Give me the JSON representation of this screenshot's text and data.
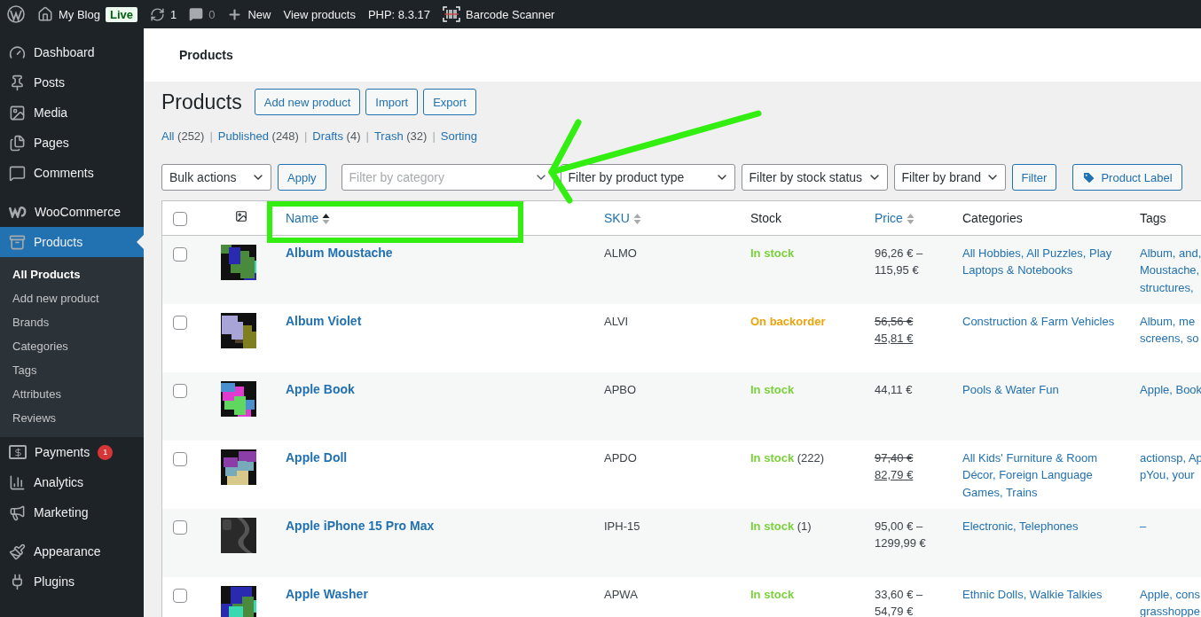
{
  "admin_bar": {
    "site": "My Blog",
    "site_badge": "Live",
    "updates": "1",
    "comments": "0",
    "new": "New",
    "links": [
      "View products",
      "PHP: 8.3.17"
    ],
    "scanner": "Barcode Scanner"
  },
  "sidebar": {
    "items": [
      {
        "kind": "dashboard",
        "label": "Dashboard",
        "selected": false
      },
      {
        "kind": "posts",
        "label": "Posts",
        "selected": false
      },
      {
        "kind": "media",
        "label": "Media",
        "selected": false
      },
      {
        "kind": "pages",
        "label": "Pages",
        "selected": false
      },
      {
        "kind": "comments",
        "label": "Comments",
        "selected": false
      },
      {
        "kind": "woo",
        "label": "WooCommerce",
        "selected": false
      },
      {
        "kind": "products",
        "label": "Products",
        "selected": true,
        "children": [
          {
            "label": "All Products",
            "selected": true
          },
          {
            "label": "Add new product",
            "selected": false
          },
          {
            "label": "Brands",
            "selected": false
          },
          {
            "label": "Categories",
            "selected": false
          },
          {
            "label": "Tags",
            "selected": false
          },
          {
            "label": "Attributes",
            "selected": false
          },
          {
            "label": "Reviews",
            "selected": false
          }
        ]
      },
      {
        "kind": "payments",
        "label": "Payments",
        "selected": false,
        "badge": "1"
      },
      {
        "kind": "analytics",
        "label": "Analytics",
        "selected": false
      },
      {
        "kind": "marketing",
        "label": "Marketing",
        "selected": false
      },
      {
        "kind": "appearance",
        "label": "Appearance",
        "selected": false
      },
      {
        "kind": "plugins",
        "label": "Plugins",
        "selected": false
      }
    ]
  },
  "header": {
    "title": "Products"
  },
  "page": {
    "title": "Products",
    "buttons": [
      "Add new product",
      "Import",
      "Export"
    ]
  },
  "views": [
    {
      "label": "All",
      "count": "(252)",
      "selected": false
    },
    {
      "separator": "|",
      "label": "Published",
      "count": "(248)",
      "selected": false
    },
    {
      "separator": "|",
      "label": "Drafts",
      "count": "(4)",
      "selected": false
    },
    {
      "separator": "|",
      "label": "Trash",
      "count": "(32)",
      "selected": false
    },
    {
      "separator": "|",
      "label": "Sorting",
      "selected": false
    }
  ],
  "filters": {
    "bulk": "Bulk actions",
    "apply": "Apply",
    "category_placeholder": "Filter by category",
    "selects": [
      "Filter by product type",
      "Filter by stock status",
      "Filter by brand"
    ],
    "filter": "Filter",
    "label_button": "Product Label"
  },
  "table": {
    "select_all": {
      "checked": false
    },
    "columns": [
      {
        "label": "Name",
        "sortable": true,
        "sorted": true
      },
      {
        "label": "SKU",
        "sortable": true,
        "sorted": false
      },
      {
        "label": "Stock",
        "sortable": false
      },
      {
        "label": "Price",
        "sortable": true,
        "sorted": false
      },
      {
        "label": "Categories",
        "sortable": false
      },
      {
        "label": "Tags",
        "sortable": false
      }
    ],
    "rows": [
      {
        "checked": false,
        "name": "Album Moustache",
        "sku": "ALMO",
        "stock": {
          "kind": "in_stock",
          "label": "In stock"
        },
        "price": {
          "kind": "range",
          "from": "96,26 € –",
          "to": "115,95 €"
        },
        "categories": "All Hobbies, All Puzzles, Play Laptops & Notebooks",
        "tags": [
          "Album, and,",
          "Moustache,",
          "structures,"
        ]
      },
      {
        "checked": false,
        "name": "Album Violet",
        "sku": "ALVI",
        "stock": {
          "kind": "backorder",
          "label": "On backorder"
        },
        "price": {
          "kind": "sale",
          "from": "56,56 €",
          "to": "45,81 €"
        },
        "categories": "Construction & Farm Vehicles",
        "tags": [
          "Album, me",
          "screens, so"
        ]
      },
      {
        "checked": false,
        "name": "Apple Book",
        "sku": "APBO",
        "stock": {
          "kind": "in_stock",
          "label": "In stock"
        },
        "price": {
          "kind": "single",
          "from": "44,11 €"
        },
        "categories": "Pools & Water Fun",
        "tags": [
          "Apple, Book"
        ]
      },
      {
        "checked": false,
        "name": "Apple Doll",
        "sku": "APDO",
        "stock": {
          "kind": "in_stock",
          "label": "In stock",
          "count": "(222)"
        },
        "price": {
          "kind": "sale",
          "from": "97,40 €",
          "to": "82,79 €"
        },
        "categories": "All Kids' Furniture & Room Décor, Foreign Language Games, Trains",
        "tags": [
          "actionsp, Ap",
          "pYou, your"
        ]
      },
      {
        "checked": false,
        "name": "Apple iPhone 15 Pro Max",
        "sku": "IPH-15",
        "stock": {
          "kind": "in_stock",
          "label": "In stock",
          "count": "(1)"
        },
        "price": {
          "kind": "range",
          "from": "95,00 € –",
          "to": "1299,99 €"
        },
        "categories": "Electronic, Telephones",
        "tags": [
          "–"
        ]
      },
      {
        "checked": false,
        "name": "Apple Washer",
        "sku": "APWA",
        "stock": {
          "kind": "in_stock",
          "label": "In stock"
        },
        "price": {
          "kind": "range",
          "from": "33,60 € –",
          "to": "54,79 €"
        },
        "categories": "Ethnic Dolls, Walkie Talkies",
        "tags": [
          "Apple, cons",
          "grasshoppe"
        ]
      }
    ]
  },
  "annotation": {
    "arrow": {
      "color": "#33ee11"
    },
    "frame": {
      "color": "#33ee11"
    }
  }
}
